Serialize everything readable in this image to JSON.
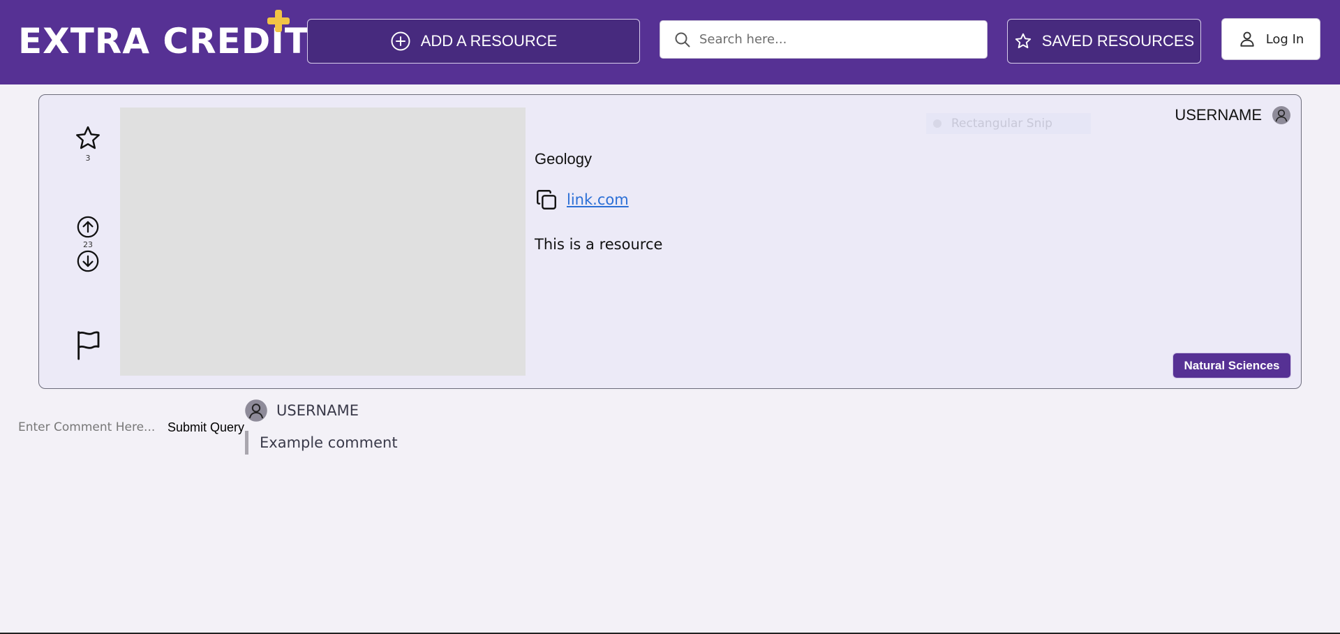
{
  "header": {
    "logo_text": "EXTRA CREDIT",
    "add_resource_label": "ADD A RESOURCE",
    "search_placeholder": "Search here...",
    "saved_resources_label": "SAVED RESOURCES",
    "login_label": "Log In"
  },
  "resource": {
    "username": "USERNAME",
    "star_count": "3",
    "vote_count": "23",
    "category": "Geology",
    "link_text": "link.com",
    "description": "This is a resource",
    "tag": "Natural Sciences",
    "overlay_text": "Rectangular Snip"
  },
  "comments": {
    "input_placeholder": "Enter Comment Here...",
    "submit_label": "Submit Query",
    "items": [
      {
        "username": "USERNAME",
        "text": "Example comment"
      }
    ]
  },
  "colors": {
    "header_bg": "#563194",
    "button_bg": "#472a7e",
    "accent_plus": "#f2c445",
    "card_bg": "#eceaf7",
    "link": "#2b6fd6"
  },
  "icons": [
    "plus-circle-icon",
    "search-icon",
    "star-icon",
    "user-icon",
    "arrow-up-circle-icon",
    "arrow-down-circle-icon",
    "flag-icon",
    "copy-icon",
    "avatar-icon"
  ]
}
